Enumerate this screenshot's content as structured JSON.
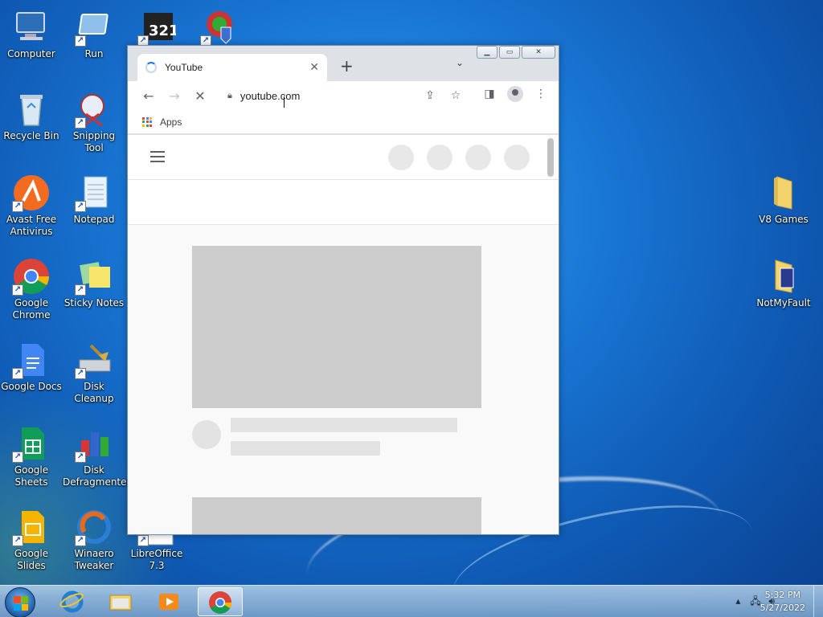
{
  "desktop": {
    "icons": [
      {
        "label": "Computer",
        "icon": "computer-icon"
      },
      {
        "label": "Run",
        "icon": "run-icon"
      },
      {
        "label": "",
        "icon": "media-player-classic-icon"
      },
      {
        "label": "",
        "icon": "security-shield-icon"
      },
      {
        "label": "Recycle Bin",
        "icon": "recycle-bin-icon"
      },
      {
        "label": "Snipping Tool",
        "icon": "snipping-tool-icon"
      },
      {
        "label": "Avast Free Antivirus",
        "icon": "avast-icon"
      },
      {
        "label": "Notepad",
        "icon": "notepad-icon"
      },
      {
        "label": "Google Chrome",
        "icon": "chrome-icon"
      },
      {
        "label": "Sticky Notes",
        "icon": "sticky-notes-icon"
      },
      {
        "label": "Google Docs",
        "icon": "google-docs-icon"
      },
      {
        "label": "Disk Cleanup",
        "icon": "disk-cleanup-icon"
      },
      {
        "label": "Google Sheets",
        "icon": "google-sheets-icon"
      },
      {
        "label": "Disk Defragmenter",
        "icon": "disk-defragmenter-icon"
      },
      {
        "label": "Google Slides",
        "icon": "google-slides-icon"
      },
      {
        "label": "Winaero Tweaker",
        "icon": "winaero-tweaker-icon"
      },
      {
        "label": "LibreOffice 7.3",
        "icon": "libreoffice-icon"
      },
      {
        "label": "V8 Games",
        "icon": "folder-icon"
      },
      {
        "label": "NotMyFault",
        "icon": "folder-icon"
      }
    ]
  },
  "browser": {
    "tab_title": "YouTube",
    "tab_close": "✕",
    "new_tab": "+",
    "tab_search": "⌄",
    "window_buttons": {
      "minimize": "▁",
      "maximize": "▭",
      "close": "✕"
    },
    "url": "youtube.com",
    "bookmarks_apps": "Apps",
    "colors": {
      "accent": "#1a73e8",
      "skeleton": "#cccccc",
      "chrome_frame": "#dee1e6"
    }
  },
  "taskbar": {
    "items": [
      "start-button",
      "internet-explorer-icon",
      "file-explorer-icon",
      "media-player-icon",
      "chrome-icon"
    ],
    "clock_time": "5:32 PM",
    "clock_date": "5/27/2022"
  }
}
